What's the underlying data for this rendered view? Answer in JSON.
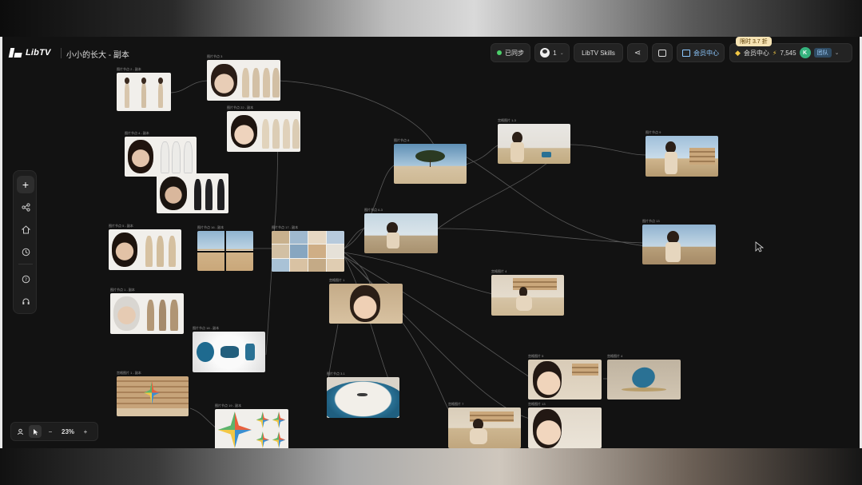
{
  "header": {
    "logo_text": "LibTV",
    "project_title": "小小的长大 - 副本",
    "sync_label": "已同步",
    "collaborators_count": "1",
    "skills_label": "LibTV Skills",
    "share_icon": "share-icon",
    "comment_icon": "comment-icon",
    "member_center_label": "会员中心",
    "promo_tag": "限时 3.7 折",
    "account_label": "会员中心",
    "credits": "7,545",
    "avatar_letter": "K",
    "team_label": "团队"
  },
  "left_toolbar": {
    "items": [
      "add-icon",
      "workflow-icon",
      "assets-icon",
      "history-icon",
      "help-icon",
      "headset-icon"
    ]
  },
  "zoom_bar": {
    "zoom_level": "23%",
    "minus": "−",
    "plus": "+"
  },
  "nodes": [
    {
      "id": "n1",
      "label": "图片节点 2 - 副本"
    },
    {
      "id": "n2",
      "label": "图片节点 3"
    },
    {
      "id": "n3",
      "label": "图片节点 22 - 副本"
    },
    {
      "id": "n4",
      "label": "图片节点 4 - 副本"
    },
    {
      "id": "n5",
      "label": ""
    },
    {
      "id": "n6",
      "label": "图片节点 5 - 副本"
    },
    {
      "id": "n7",
      "label": "图片节点 16 - 副本"
    },
    {
      "id": "n8",
      "label": "图片节点 17 - 副本"
    },
    {
      "id": "n9",
      "label": "图片节点 1 - 副本"
    },
    {
      "id": "n10",
      "label": "图片节点 18 - 副本"
    },
    {
      "id": "n11",
      "label": "宫格图片 1 - 副本"
    },
    {
      "id": "n12",
      "label": "图片节点 19 - 副本"
    },
    {
      "id": "n13",
      "label": "图片节点 8"
    },
    {
      "id": "n14",
      "label": "图片节点 6-3"
    },
    {
      "id": "n15",
      "label": "宫格图片 1"
    },
    {
      "id": "n16",
      "label": "图片节点 3.1"
    },
    {
      "id": "n17",
      "label": "宫格图片 1-3"
    },
    {
      "id": "n18",
      "label": "图片节点 9"
    },
    {
      "id": "n19",
      "label": "图片节点 13"
    },
    {
      "id": "n20",
      "label": "宫格图片 4"
    },
    {
      "id": "n21",
      "label": "宫格图片 5"
    },
    {
      "id": "n22",
      "label": "宫格图片 4"
    },
    {
      "id": "n23",
      "label": "宫格图片 7"
    },
    {
      "id": "n24",
      "label": "宫格图片 13"
    }
  ]
}
